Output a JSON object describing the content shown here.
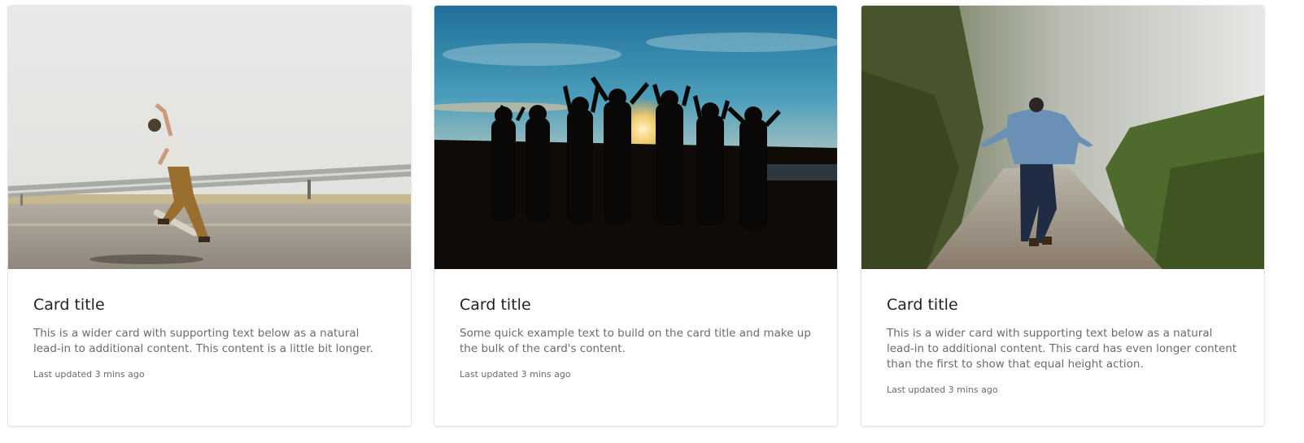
{
  "cards": [
    {
      "image": "skateboarder-photo",
      "title": "Card title",
      "text": "This is a wider card with supporting text below as a natural lead-in to additional content. This content is a little bit longer.",
      "meta": "Last updated 3 mins ago"
    },
    {
      "image": "sunset-group-silhouette-photo",
      "title": "Card title",
      "text": "Some quick example text to build on the card title and make up the bulk of the card's content.",
      "meta": "Last updated 3 mins ago"
    },
    {
      "image": "foggy-path-person-photo",
      "title": "Card title",
      "text": "This is a wider card with supporting text below as a natural lead-in to additional content. This card has even longer content than the first to show that equal height action.",
      "meta": "Last updated 3 mins ago"
    }
  ]
}
